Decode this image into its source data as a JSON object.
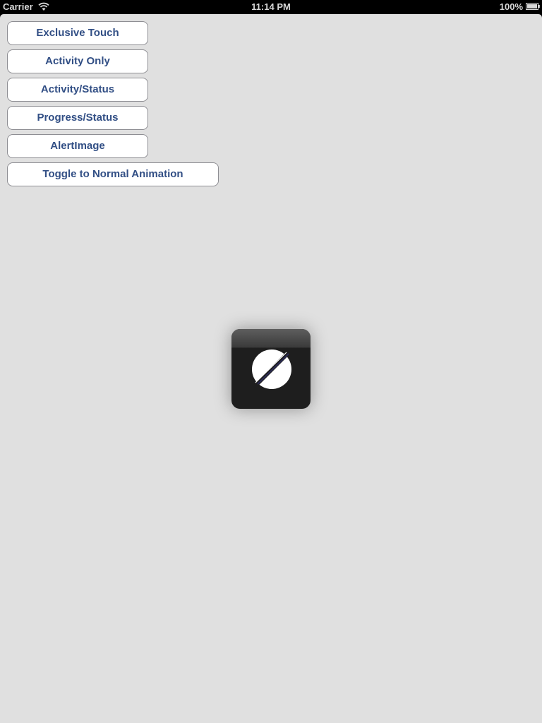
{
  "status_bar": {
    "carrier": "Carrier",
    "time": "11:14 PM",
    "battery_percent": "100%",
    "wifi_icon": "wifi-icon",
    "battery_icon": "battery-icon"
  },
  "buttons": {
    "exclusive_touch": "Exclusive Touch",
    "activity_only": "Activity Only",
    "activity_status": "Activity/Status",
    "progress_status": "Progress/Status",
    "alert_image": "AlertImage",
    "toggle_animation": "Toggle to Normal Animation"
  },
  "hud": {
    "icon": "no-entry-icon"
  },
  "colors": {
    "background": "#e0e0e0",
    "button_text": "#324f85",
    "hud_background": "#1e1e1e"
  }
}
